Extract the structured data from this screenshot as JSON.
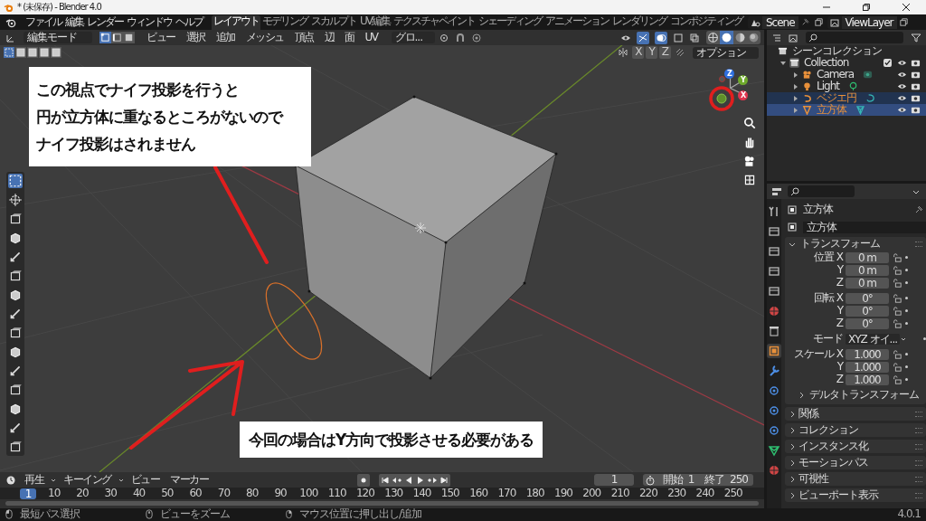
{
  "window": {
    "title": "* (未保存) - Blender 4.0"
  },
  "menu": [
    "ファイル",
    "編集",
    "レンダー",
    "ウィンドウ",
    "ヘルプ"
  ],
  "workspaces": [
    {
      "label": "レイアウト",
      "selected": true
    },
    {
      "label": "モデリング",
      "selected": false
    },
    {
      "label": "スカルプト",
      "selected": false
    },
    {
      "label": "UV編集",
      "selected": false
    },
    {
      "label": "テクスチャペイント",
      "selected": false
    },
    {
      "label": "シェーディング",
      "selected": false
    },
    {
      "label": "アニメーション",
      "selected": false
    },
    {
      "label": "レンダリング",
      "selected": false
    },
    {
      "label": "コンポジティング",
      "selected": false
    }
  ],
  "scene": "Scene",
  "view_layer": "ViewLayer",
  "viewport": {
    "mode": "編集モード",
    "select_modes": [
      {
        "kind": "vertex",
        "selected": true
      },
      {
        "kind": "edge",
        "selected": false
      },
      {
        "kind": "face",
        "selected": false
      }
    ],
    "menus": [
      "ビュー",
      "選択",
      "追加",
      "メッシュ",
      "頂点",
      "辺",
      "面",
      "UV"
    ],
    "orientation": "グロ...",
    "mirror_axes": [
      "X",
      "Y",
      "Z"
    ],
    "options": "オプション",
    "gizmo_axes": [
      {
        "label": "Z",
        "color": "#2f6fe0"
      },
      {
        "label": "Y",
        "color": "#6ea92c"
      },
      {
        "label": "X",
        "color": "#e0344f"
      }
    ],
    "annotations": [
      {
        "lines": [
          "この視点でナイフ投影を行うと",
          "円が立方体に重なるところがないので",
          "ナイフ投影はされません"
        ]
      },
      {
        "lines": [
          "今回の場合はY方向で投影させる必要がある"
        ]
      }
    ]
  },
  "outliner": {
    "root": "シーンコレクション",
    "collection": {
      "name": "Collection",
      "checked": true,
      "children": [
        {
          "name": "Camera",
          "kind": "camera",
          "selected": false,
          "active": false
        },
        {
          "name": "Light",
          "kind": "light",
          "selected": false,
          "active": false
        },
        {
          "name": "ベジエ円",
          "kind": "curve",
          "selected": true,
          "active": false
        },
        {
          "name": "立方体",
          "kind": "mesh",
          "selected": true,
          "active": true
        }
      ]
    }
  },
  "properties": {
    "tabs": [
      {
        "kind": "tool",
        "selected": false
      },
      {
        "kind": "render",
        "selected": false
      },
      {
        "kind": "output",
        "selected": false
      },
      {
        "kind": "view_layer",
        "selected": false
      },
      {
        "kind": "scene",
        "selected": false
      },
      {
        "kind": "world",
        "selected": false
      },
      {
        "kind": "collection",
        "selected": false
      },
      {
        "kind": "object",
        "selected": true
      },
      {
        "kind": "modifier",
        "selected": false
      },
      {
        "kind": "particles",
        "selected": false
      },
      {
        "kind": "physics",
        "selected": false
      },
      {
        "kind": "constraints",
        "selected": false
      },
      {
        "kind": "data",
        "selected": false
      },
      {
        "kind": "material",
        "selected": false
      }
    ],
    "object_name": "立方体",
    "datablock": "立方体",
    "transform": {
      "title": "トランスフォーム",
      "expanded": true,
      "groups": [
        [
          {
            "label": "位置 X",
            "value": "0 m",
            "kind": "number"
          },
          {
            "label": "Y",
            "value": "0 m",
            "kind": "number"
          },
          {
            "label": "Z",
            "value": "0 m",
            "kind": "number"
          }
        ],
        [
          {
            "label": "回転 X",
            "value": "0°",
            "kind": "number"
          },
          {
            "label": "Y",
            "value": "0°",
            "kind": "number"
          },
          {
            "label": "Z",
            "value": "0°",
            "kind": "number"
          }
        ],
        [
          {
            "label": "モード",
            "value": "XYZ オイ...",
            "kind": "dropdown"
          }
        ],
        [
          {
            "label": "スケール X",
            "value": "1.000",
            "kind": "number"
          },
          {
            "label": "Y",
            "value": "1.000",
            "kind": "number"
          },
          {
            "label": "Z",
            "value": "1.000",
            "kind": "number"
          }
        ]
      ],
      "subpanel": "デルタトランスフォーム"
    },
    "panels": [
      "関係",
      "コレクション",
      "インスタンス化",
      "モーションパス",
      "可視性",
      "ビューポート表示"
    ]
  },
  "timeline": {
    "menus": [
      "再生",
      "キーイング",
      "ビュー",
      "マーカー"
    ],
    "current_frame": "1",
    "frame_field": "1",
    "start_label": "開始",
    "start": "1",
    "end_label": "終了",
    "end": "250",
    "ticks": [
      "10",
      "20",
      "30",
      "40",
      "50",
      "60",
      "70",
      "80",
      "90",
      "100",
      "110",
      "120",
      "130",
      "140",
      "150",
      "160",
      "170",
      "180",
      "190",
      "200",
      "210",
      "220",
      "230",
      "240",
      "250"
    ]
  },
  "status": [
    {
      "kind": "left",
      "text": "最短パス選択"
    },
    {
      "kind": "middle",
      "text": "ビューをズーム"
    },
    {
      "kind": "right",
      "text": "マウス位置に押し出し/追加"
    }
  ],
  "version": "4.0.1"
}
